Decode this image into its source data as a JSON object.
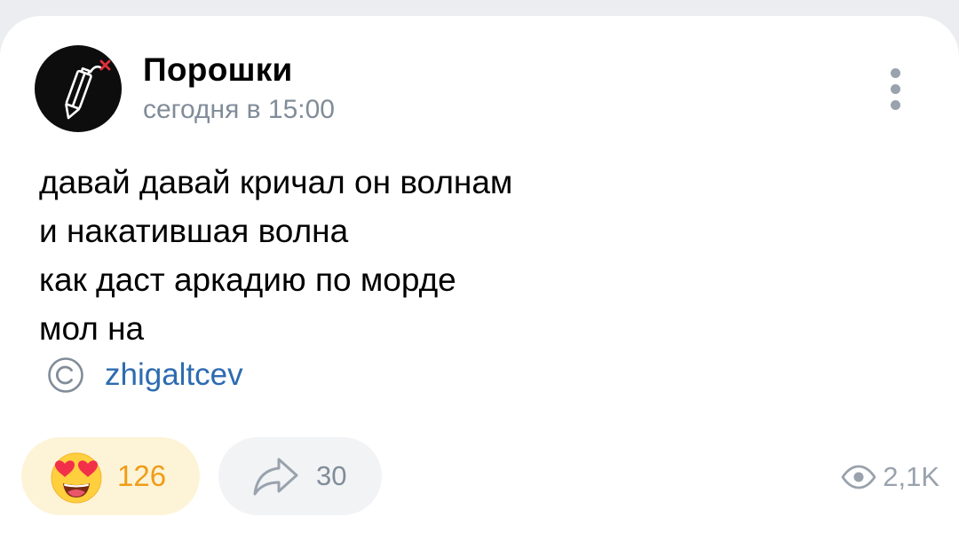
{
  "post": {
    "author": "Порошки",
    "time": "сегодня в 15:00",
    "lines": [
      "давай давай кричал он волнам",
      "и накатившая волна",
      "как даст аркадию по морде",
      "мол на"
    ],
    "copyright_author": "zhigaltcev"
  },
  "footer": {
    "reaction_count": "126",
    "share_count": "30",
    "views": "2,1K"
  },
  "icons": {
    "avatar": "pencil-dynamite-logo",
    "menu": "more-vertical-icon",
    "copyright": "copyright-icon",
    "reaction": "heart-eyes-emoji",
    "share": "share-arrow-icon",
    "views": "eye-icon"
  },
  "colors": {
    "background": "#ebedf0",
    "card": "#ffffff",
    "secondary_text": "#818c99",
    "link": "#2d6bb0",
    "reaction_bg": "#fdf4d8",
    "reaction_text": "#f09c16",
    "button_bg": "#f2f3f5"
  }
}
